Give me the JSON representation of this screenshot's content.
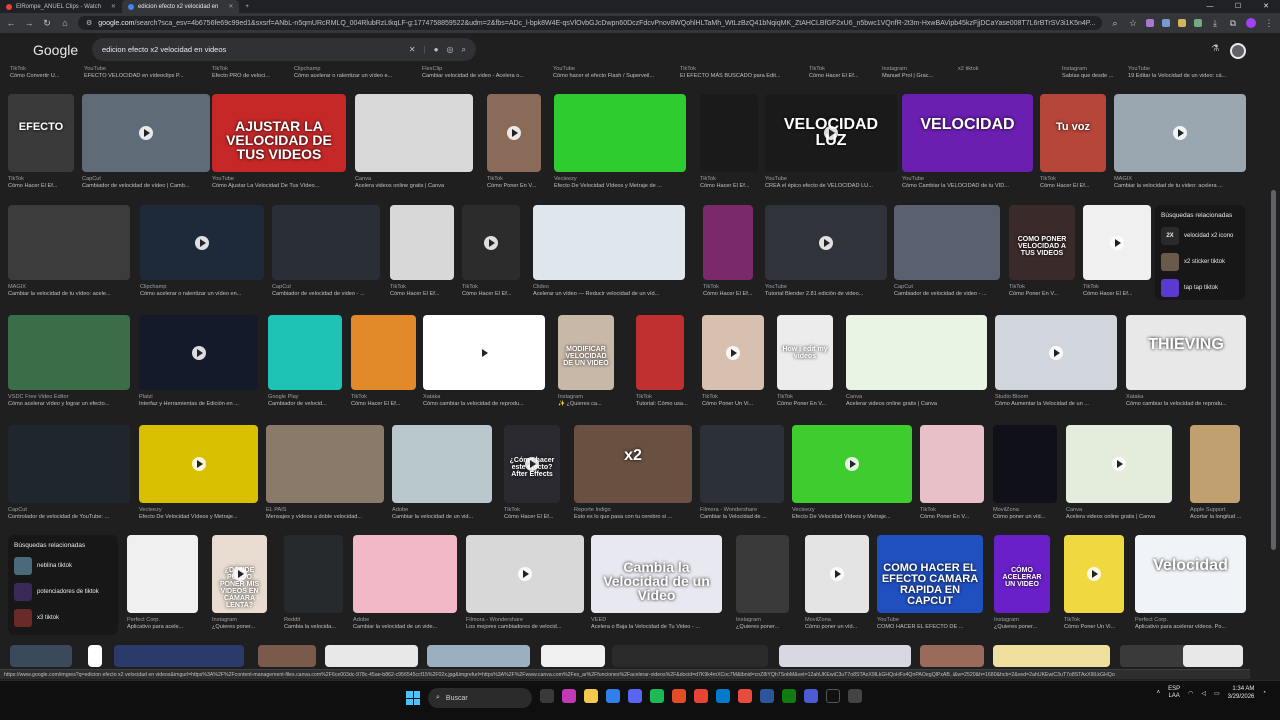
{
  "tabs": [
    {
      "label": "ElRompe_ANUEL Clips - Watch"
    },
    {
      "label": "edicion efecto x2 velocidad en"
    }
  ],
  "address": {
    "host": "google.com",
    "path": "/search?sca_esv=4b6756fe69c99ed1&sxsrf=ANbL-n5qmURcRMLQ_004RlubRzLtkqLF-g:1774758859522&udm=2&fbs=ADc_l-bpk8W4E-qsVlOvbGJcDwpn60DczFdcvPnov8WQohlHLTaMh_WtLzBzQ41bNqiqMK_ZtAHCLBfGF2xU6_n5bwc1VQnfR-2t3m-HxwBAVipb45kzFjjDCaYase008T7L6rBTrSV3i1K5n4P..."
  },
  "search": {
    "query": "edicion efecto x2 velocidad en videos"
  },
  "logo": "Google",
  "row0": [
    {
      "src": "TikTok",
      "title": "Cómo Convertir U..."
    },
    {
      "src": "YouTube",
      "title": "EFECTO VELOCIDAD en videoclips P..."
    },
    {
      "src": "TikTok",
      "title": "Efecto PRO de veloci..."
    },
    {
      "src": "Clipchamp",
      "title": "Cómo acelerar o ralentizar un vídeo e..."
    },
    {
      "src": "FlexClip",
      "title": "Cambiar velocidad de video - Acelera o..."
    },
    {
      "src": "YouTube",
      "title": "Cómo hacer el efecto Flash / Superveil..."
    },
    {
      "src": "TikTok",
      "title": "El EFECTO MÁS BUSCADO para Edit..."
    },
    {
      "src": "TikTok",
      "title": "Cómo Hacer El Ef..."
    },
    {
      "src": "Instagram",
      "title": "Manuel Prol | Grac..."
    },
    {
      "src": "x2 tiktok",
      "title": ""
    },
    {
      "src": "Instagram",
      "title": "Sabías que desde ..."
    },
    {
      "src": "YouTube",
      "title": "19 Editar la Velocidad de un video: cá..."
    }
  ],
  "row1": [
    {
      "src": "TikTok",
      "title": "Cómo Hacer El Ef...",
      "overlay": "EFECTO"
    },
    {
      "src": "CapCut",
      "title": "Cambiador de velocidad de vídeo | Camb...",
      "overlay": ""
    },
    {
      "src": "YouTube",
      "title": "Cómo Ajustar La Velocidad De Tus Vídeo...",
      "overlay": "AJUSTAR LA VELOCIDAD DE TUS VIDEOS"
    },
    {
      "src": "Canva",
      "title": "Acelera videos online gratis | Canva",
      "overlay": ""
    },
    {
      "src": "TikTok",
      "title": "Cómo Poner En V...",
      "overlay": ""
    },
    {
      "src": "Vecteezy",
      "title": "Efecto De Velocidad Vídeos y Metraje de ...",
      "overlay": ""
    },
    {
      "src": "TikTok",
      "title": "Cómo Hacer El Ef...",
      "overlay": ""
    },
    {
      "src": "YouTube",
      "title": "CREA el épico efecto de VELOCIDAD LU...",
      "overlay": "VELOCIDAD LUZ"
    },
    {
      "src": "YouTube",
      "title": "Cómo Cambiar la VELOCIDAD de tu VID...",
      "overlay": "VELOCIDAD"
    },
    {
      "src": "TikTok",
      "title": "Cómo Hacer El Ef...",
      "overlay": "Tu voz"
    },
    {
      "src": "MAGIX",
      "title": "Cambiar la velocidad de tu video: acelera ...",
      "overlay": ""
    }
  ],
  "row2": [
    {
      "src": "MAGIX",
      "title": "Cambiar la velocidad de tu vídeo: acele..."
    },
    {
      "src": "Clipchamp",
      "title": "Cómo acelerar o ralentizar un vídeo en..."
    },
    {
      "src": "CapCut",
      "title": "Cambiador de velocidad de video - ..."
    },
    {
      "src": "TikTok",
      "title": "Cómo Hacer El Ef..."
    },
    {
      "src": "TikTok",
      "title": "Cómo Hacer El Ef..."
    },
    {
      "src": "Clideo",
      "title": "Acelerar un vídeo — Reducir velocidad de un víd..."
    },
    {
      "src": "TikTok",
      "title": "Cómo Hacer El Ef..."
    },
    {
      "src": "YouTube",
      "title": "Tutorial Blender 2.81 edición de video..."
    },
    {
      "src": "CapCut",
      "title": "Cambiador de velocidad de video - ..."
    },
    {
      "src": "TikTok",
      "title": "Cómo Poner En V...",
      "overlay": "COMO PONER VELOCIDAD A TUS VIDEOS"
    },
    {
      "src": "TikTok",
      "title": "Cómo Hacer El Ef..."
    }
  ],
  "related1": {
    "heading": "Búsquedas relacionadas",
    "items": [
      {
        "label": "velocidad x2 icono",
        "thumb": "2X"
      },
      {
        "label": "x2 sticker tiktok"
      },
      {
        "label": "tap tap tiktok"
      }
    ]
  },
  "row3": [
    {
      "src": "VSDC Free Video Editor",
      "title": "Cómo acelerar vídeo y lograr un efecto..."
    },
    {
      "src": "Platzi",
      "title": "Interfaz y Herramientas de Edición en ..."
    },
    {
      "src": "Google Play",
      "title": "Cambiador de velocid..."
    },
    {
      "src": "TikTok",
      "title": "Cómo Hacer El Ef..."
    },
    {
      "src": "Xataka",
      "title": "Cómo cambiar la velocidad de reprodu..."
    },
    {
      "src": "Instagram",
      "title": "✨ ¿Quieres ca...",
      "overlay": "MODIFICAR VELOCIDAD DE UN VIDEO"
    },
    {
      "src": "TikTok",
      "title": "Tutorial: Cómo usa..."
    },
    {
      "src": "TikTok",
      "title": "Cómo Poner Un Vi..."
    },
    {
      "src": "TikTok",
      "title": "Cómo Poner En V...",
      "overlay": "How i edit my videos"
    },
    {
      "src": "Canva",
      "title": "Acelerar videos online gratis | Canva"
    },
    {
      "src": "Studio Bloom",
      "title": "Cómo Aumentar la Velocidad de un ..."
    },
    {
      "src": "Xataka",
      "title": "Cómo cambiar la velocidad de reprodu...",
      "overlay": "THIEVING"
    }
  ],
  "row4": [
    {
      "src": "CapCut",
      "title": "Controlador de velocidad de YouTube: ..."
    },
    {
      "src": "Vecteezy",
      "title": "Efecto De Velocidad Vídeos y Metraje..."
    },
    {
      "src": "EL PAÍS",
      "title": "Mensajes y vídeos a doble velocidad..."
    },
    {
      "src": "Adobe",
      "title": "Cambiar la velocidad de un vid..."
    },
    {
      "src": "TikTok",
      "title": "Cómo Hacer El Ef...",
      "overlay": "¿Cómo hacer este efecto? After Effects"
    },
    {
      "src": "Reporte Índigo",
      "title": "Esto es lo que pasa con tu cerebro si ...",
      "overlay": "x2"
    },
    {
      "src": "Filmora - Wondershare",
      "title": "Cambiar la Velocidad de ..."
    },
    {
      "src": "Vecteezy",
      "title": "Efecto De Velocidad Vídeos y Metraje..."
    },
    {
      "src": "TikTok",
      "title": "Cómo Poner En V..."
    },
    {
      "src": "MovilZona",
      "title": "Cómo poner un víd..."
    },
    {
      "src": "Canva",
      "title": "Acelera videos online gratis | Canva"
    },
    {
      "src": "Apple Support",
      "title": "Acortar la longitud ..."
    }
  ],
  "related2": {
    "heading": "Búsquedas relacionadas",
    "items": [
      {
        "label": "neblina tiktok"
      },
      {
        "label": "potenciadores de tiktok"
      },
      {
        "label": "x3 tiktok"
      }
    ]
  },
  "row5": [
    {
      "src": "Perfect Corp.",
      "title": "Aplicativo para acele..."
    },
    {
      "src": "Instagram",
      "title": "¿Quieres poner...",
      "overlay": "¿DÓNDE PUEDO PONER MIS VIDEOS EN CÁMARA LENTA?"
    },
    {
      "src": "Reddit",
      "title": "Cambia la velocida..."
    },
    {
      "src": "Adobe",
      "title": "Cambiar la velocidad de un vide..."
    },
    {
      "src": "Filmora - Wondershare",
      "title": "Los mejores cambiadores de velocid..."
    },
    {
      "src": "VEED",
      "title": "Acelera o Baja la Velocidad de Tu Video - ...",
      "overlay": "Cambia la Velocidad de un Video"
    },
    {
      "src": "Instagram",
      "title": "¿Quieres poner..."
    },
    {
      "src": "MovilZona",
      "title": "Cómo poner un víd..."
    },
    {
      "src": "YouTube",
      "title": "COMO HACER EL EFECTO DE ...",
      "overlay": "COMO HACER EL EFECTO CAMARA RAPIDA EN CAPCUT"
    },
    {
      "src": "Instagram",
      "title": "¿Quieres poner...",
      "overlay": "CÓMO ACELERAR UN VIDEO"
    },
    {
      "src": "TikTok",
      "title": "Cómo Poner Un Vi..."
    },
    {
      "src": "Perfect Corp.",
      "title": "Aplicativo para acelerar vídeos. Po...",
      "overlay": "Velocidad"
    }
  ],
  "status_url": "https://www.google.com/imgres?q=edicion efecto x2 velocidad en videos&imgurl=https%3A%2F%2Fcontent-management-files.canva.com%2F6ce003dc-978c-45ae-b862-c956545ccf15%2F02x.jpg&imgrefurl=https%3A%2F%2Fwww.canva.com%2Fes_ar%2Ffunciones%2Facelerar-videos%2F&docid=d7K9k4mXCoc7M&tbnid=cnZ8iYQh7SobM&vet=12ahUKEwiC3uT7o8STAxX9lLkGHQoHFs4QnPAOegQlPxAB..i&w=2520&h=1680&hcb=2&ved=2ahUKEwiC3uT7o8STAxX9lLkGHQo",
  "taskbar": {
    "search": "Buscar",
    "lang": "ESP",
    "region": "LAA",
    "time": "1:34 AM",
    "date": "3/29/2026"
  },
  "colors": {
    "bg": "#1f1f1f",
    "accent": "#8ab4f8",
    "green": "#1ec81e"
  }
}
